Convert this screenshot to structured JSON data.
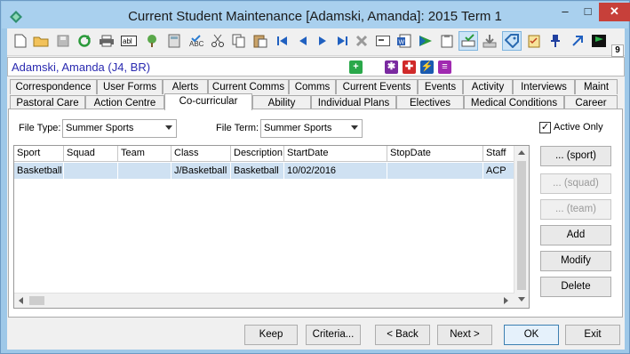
{
  "window": {
    "title": "Current Student Maintenance  [Adamski, Amanda]:  2015 Term 1",
    "minimize": "–",
    "maximize": "□",
    "close": "✕"
  },
  "toolbar": {
    "badge": "9",
    "icons": [
      "new-icon",
      "open-folder-icon",
      "save-icon",
      "refresh-icon",
      "print-icon",
      "text-label-icon",
      "tree-icon",
      "calculator-icon",
      "spell-check-icon",
      "cut-icon",
      "copy-icon",
      "paste-icon",
      "first-record-icon",
      "previous-record-icon",
      "next-record-icon",
      "last-record-icon",
      "delete-icon",
      "card-icon",
      "word-doc-icon",
      "send-icon",
      "clipboard-icon",
      "inbox-icon",
      "download-icon",
      "tag-icon",
      "checklist-icon",
      "pin-icon",
      "arrow-up-right-icon",
      "flag-icon"
    ]
  },
  "student": {
    "name": "Adamski, Amanda (J4, BR)"
  },
  "tabs": {
    "row1": [
      "Correspondence",
      "User Forms",
      "Alerts",
      "Current Comms",
      "Comms",
      "Current Events",
      "Events",
      "Activity",
      "Interviews",
      "Maint"
    ],
    "row2": [
      "Pastoral Care",
      "Action Centre",
      "Co-curricular",
      "Ability",
      "Individual Plans",
      "Electives",
      "Medical Conditions",
      "Career"
    ],
    "active": "Co-curricular"
  },
  "filters": {
    "file_type_label": "File Type:",
    "file_type_value": "Summer Sports",
    "file_term_label": "File Term:",
    "file_term_value": "Summer Sports",
    "active_only_label": "Active Only",
    "active_only_checked": "✓"
  },
  "grid": {
    "columns": [
      "Sport",
      "Squad",
      "Team",
      "Class",
      "Description",
      "StartDate",
      "StopDate",
      "Staff"
    ],
    "rows": [
      [
        "Basketball",
        "",
        "",
        "J/Basketball",
        "Basketball",
        "10/02/2016",
        "",
        "ACP"
      ]
    ]
  },
  "side_buttons": {
    "sport": "... (sport)",
    "squad": "... (squad)",
    "team": "... (team)",
    "add": "Add",
    "modify": "Modify",
    "delete": "Delete"
  },
  "bottom_buttons": {
    "keep": "Keep",
    "criteria": "Criteria...",
    "back": "< Back",
    "next": "Next >",
    "ok": "OK",
    "exit": "Exit"
  },
  "colors": {
    "title_bar": "#a9d0ee",
    "close_button": "#c7403a",
    "selected_row": "#cfe1f2",
    "student_name": "#2a2ab0"
  }
}
